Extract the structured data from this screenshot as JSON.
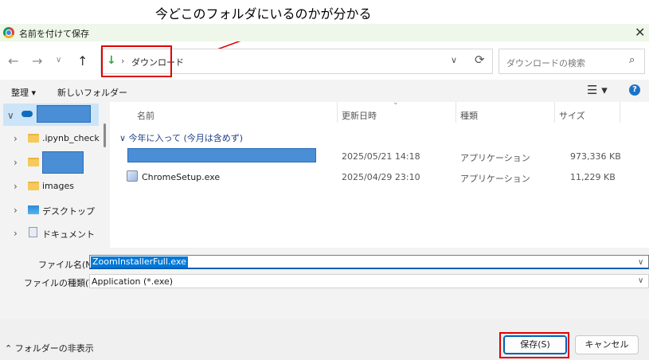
{
  "annotation": {
    "text": "今どこのフォルダにいるのかが分かる"
  },
  "window": {
    "title": "名前を付けて保存",
    "close": "✕"
  },
  "nav": {
    "back": "←",
    "forward": "→",
    "recent": "∨",
    "up": "↑"
  },
  "address": {
    "arrow": "↓",
    "separator": "›",
    "path": "ダウンロード",
    "dropdown": "∨",
    "refresh": "⟳"
  },
  "search": {
    "placeholder": "ダウンロードの検索",
    "icon": "⌕"
  },
  "commandbar": {
    "organize": "整理 ▾",
    "new_folder": "新しいフォルダー",
    "view": "☰ ▾",
    "help": "?"
  },
  "sidebar": {
    "items": [
      {
        "chevron": "∨",
        "label": ""
      },
      {
        "chevron": "›",
        "label": ".ipynb_checkpoints"
      },
      {
        "chevron": "›",
        "label": ""
      },
      {
        "chevron": "›",
        "label": "images"
      },
      {
        "chevron": "›",
        "label": "デスクトップ"
      },
      {
        "chevron": "›",
        "label": "ドキュメント"
      }
    ]
  },
  "filelist": {
    "columns": {
      "name": "名前",
      "modified": "更新日時",
      "type": "種類",
      "size": "サイズ"
    },
    "sort_indicator": "⌄",
    "group": "∨  今年に入って (今月は含めず)",
    "rows": [
      {
        "name": "",
        "modified": "2025/05/21 14:18",
        "type": "アプリケーション",
        "size": "973,336 KB"
      },
      {
        "name": "ChromeSetup.exe",
        "modified": "2025/04/29 23:10",
        "type": "アプリケーション",
        "size": "11,229 KB"
      }
    ]
  },
  "form": {
    "filename_label": "ファイル名(N):",
    "filename_value": "ZoomInstallerFull.exe",
    "filetype_label": "ファイルの種類(T):",
    "filetype_value": "Application (*.exe)",
    "select_arrow": "∨"
  },
  "footer": {
    "toggle_folders": "⌃ フォルダーの非表示",
    "save": "保存(S)",
    "cancel": "キャンセル"
  }
}
